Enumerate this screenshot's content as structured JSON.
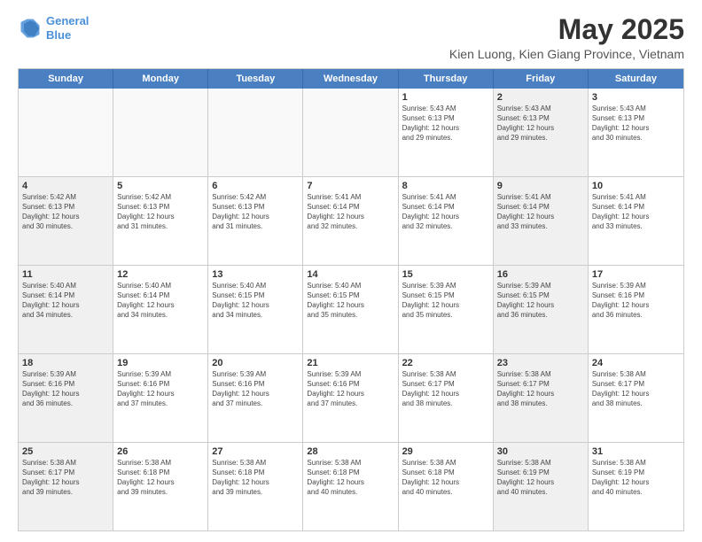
{
  "header": {
    "logo_line1": "General",
    "logo_line2": "Blue",
    "title": "May 2025",
    "subtitle": "Kien Luong, Kien Giang Province, Vietnam"
  },
  "days_of_week": [
    "Sunday",
    "Monday",
    "Tuesday",
    "Wednesday",
    "Thursday",
    "Friday",
    "Saturday"
  ],
  "weeks": [
    [
      {
        "day": "",
        "info": "",
        "shaded": false,
        "empty": true
      },
      {
        "day": "",
        "info": "",
        "shaded": false,
        "empty": true
      },
      {
        "day": "",
        "info": "",
        "shaded": false,
        "empty": true
      },
      {
        "day": "",
        "info": "",
        "shaded": false,
        "empty": true
      },
      {
        "day": "1",
        "info": "Sunrise: 5:43 AM\nSunset: 6:13 PM\nDaylight: 12 hours\nand 29 minutes.",
        "shaded": false,
        "empty": false
      },
      {
        "day": "2",
        "info": "Sunrise: 5:43 AM\nSunset: 6:13 PM\nDaylight: 12 hours\nand 29 minutes.",
        "shaded": true,
        "empty": false
      },
      {
        "day": "3",
        "info": "Sunrise: 5:43 AM\nSunset: 6:13 PM\nDaylight: 12 hours\nand 30 minutes.",
        "shaded": false,
        "empty": false
      }
    ],
    [
      {
        "day": "4",
        "info": "Sunrise: 5:42 AM\nSunset: 6:13 PM\nDaylight: 12 hours\nand 30 minutes.",
        "shaded": true,
        "empty": false
      },
      {
        "day": "5",
        "info": "Sunrise: 5:42 AM\nSunset: 6:13 PM\nDaylight: 12 hours\nand 31 minutes.",
        "shaded": false,
        "empty": false
      },
      {
        "day": "6",
        "info": "Sunrise: 5:42 AM\nSunset: 6:13 PM\nDaylight: 12 hours\nand 31 minutes.",
        "shaded": false,
        "empty": false
      },
      {
        "day": "7",
        "info": "Sunrise: 5:41 AM\nSunset: 6:14 PM\nDaylight: 12 hours\nand 32 minutes.",
        "shaded": false,
        "empty": false
      },
      {
        "day": "8",
        "info": "Sunrise: 5:41 AM\nSunset: 6:14 PM\nDaylight: 12 hours\nand 32 minutes.",
        "shaded": false,
        "empty": false
      },
      {
        "day": "9",
        "info": "Sunrise: 5:41 AM\nSunset: 6:14 PM\nDaylight: 12 hours\nand 33 minutes.",
        "shaded": true,
        "empty": false
      },
      {
        "day": "10",
        "info": "Sunrise: 5:41 AM\nSunset: 6:14 PM\nDaylight: 12 hours\nand 33 minutes.",
        "shaded": false,
        "empty": false
      }
    ],
    [
      {
        "day": "11",
        "info": "Sunrise: 5:40 AM\nSunset: 6:14 PM\nDaylight: 12 hours\nand 34 minutes.",
        "shaded": true,
        "empty": false
      },
      {
        "day": "12",
        "info": "Sunrise: 5:40 AM\nSunset: 6:14 PM\nDaylight: 12 hours\nand 34 minutes.",
        "shaded": false,
        "empty": false
      },
      {
        "day": "13",
        "info": "Sunrise: 5:40 AM\nSunset: 6:15 PM\nDaylight: 12 hours\nand 34 minutes.",
        "shaded": false,
        "empty": false
      },
      {
        "day": "14",
        "info": "Sunrise: 5:40 AM\nSunset: 6:15 PM\nDaylight: 12 hours\nand 35 minutes.",
        "shaded": false,
        "empty": false
      },
      {
        "day": "15",
        "info": "Sunrise: 5:39 AM\nSunset: 6:15 PM\nDaylight: 12 hours\nand 35 minutes.",
        "shaded": false,
        "empty": false
      },
      {
        "day": "16",
        "info": "Sunrise: 5:39 AM\nSunset: 6:15 PM\nDaylight: 12 hours\nand 36 minutes.",
        "shaded": true,
        "empty": false
      },
      {
        "day": "17",
        "info": "Sunrise: 5:39 AM\nSunset: 6:16 PM\nDaylight: 12 hours\nand 36 minutes.",
        "shaded": false,
        "empty": false
      }
    ],
    [
      {
        "day": "18",
        "info": "Sunrise: 5:39 AM\nSunset: 6:16 PM\nDaylight: 12 hours\nand 36 minutes.",
        "shaded": true,
        "empty": false
      },
      {
        "day": "19",
        "info": "Sunrise: 5:39 AM\nSunset: 6:16 PM\nDaylight: 12 hours\nand 37 minutes.",
        "shaded": false,
        "empty": false
      },
      {
        "day": "20",
        "info": "Sunrise: 5:39 AM\nSunset: 6:16 PM\nDaylight: 12 hours\nand 37 minutes.",
        "shaded": false,
        "empty": false
      },
      {
        "day": "21",
        "info": "Sunrise: 5:39 AM\nSunset: 6:16 PM\nDaylight: 12 hours\nand 37 minutes.",
        "shaded": false,
        "empty": false
      },
      {
        "day": "22",
        "info": "Sunrise: 5:38 AM\nSunset: 6:17 PM\nDaylight: 12 hours\nand 38 minutes.",
        "shaded": false,
        "empty": false
      },
      {
        "day": "23",
        "info": "Sunrise: 5:38 AM\nSunset: 6:17 PM\nDaylight: 12 hours\nand 38 minutes.",
        "shaded": true,
        "empty": false
      },
      {
        "day": "24",
        "info": "Sunrise: 5:38 AM\nSunset: 6:17 PM\nDaylight: 12 hours\nand 38 minutes.",
        "shaded": false,
        "empty": false
      }
    ],
    [
      {
        "day": "25",
        "info": "Sunrise: 5:38 AM\nSunset: 6:17 PM\nDaylight: 12 hours\nand 39 minutes.",
        "shaded": true,
        "empty": false
      },
      {
        "day": "26",
        "info": "Sunrise: 5:38 AM\nSunset: 6:18 PM\nDaylight: 12 hours\nand 39 minutes.",
        "shaded": false,
        "empty": false
      },
      {
        "day": "27",
        "info": "Sunrise: 5:38 AM\nSunset: 6:18 PM\nDaylight: 12 hours\nand 39 minutes.",
        "shaded": false,
        "empty": false
      },
      {
        "day": "28",
        "info": "Sunrise: 5:38 AM\nSunset: 6:18 PM\nDaylight: 12 hours\nand 40 minutes.",
        "shaded": false,
        "empty": false
      },
      {
        "day": "29",
        "info": "Sunrise: 5:38 AM\nSunset: 6:18 PM\nDaylight: 12 hours\nand 40 minutes.",
        "shaded": false,
        "empty": false
      },
      {
        "day": "30",
        "info": "Sunrise: 5:38 AM\nSunset: 6:19 PM\nDaylight: 12 hours\nand 40 minutes.",
        "shaded": true,
        "empty": false
      },
      {
        "day": "31",
        "info": "Sunrise: 5:38 AM\nSunset: 6:19 PM\nDaylight: 12 hours\nand 40 minutes.",
        "shaded": false,
        "empty": false
      }
    ]
  ],
  "colors": {
    "header_bg": "#4a7fc1",
    "shaded_bg": "#f0f0f0",
    "empty_bg": "#f9f9f9"
  }
}
